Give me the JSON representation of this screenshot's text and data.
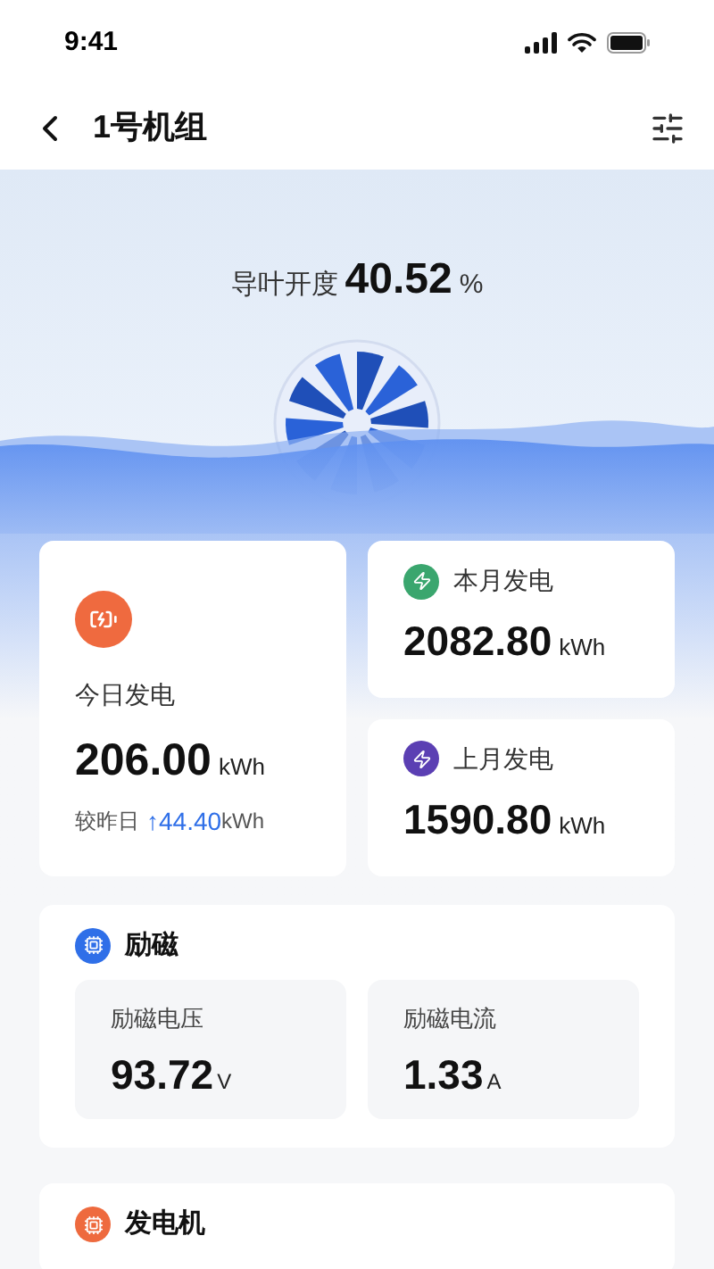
{
  "status_bar": {
    "time": "9:41"
  },
  "header": {
    "title": "1号机组"
  },
  "guide_vane": {
    "label": "导叶开度",
    "value": "40.52",
    "unit": "%"
  },
  "today": {
    "label": "今日发电",
    "value": "206.00",
    "unit": "kWh",
    "compare_label": "较昨日",
    "trend_arrow": "↑",
    "change": "44.40",
    "change_unit": "kWh"
  },
  "monthly": [
    {
      "label": "本月发电",
      "value": "2082.80",
      "unit": "kWh",
      "color": "#3aa66e"
    },
    {
      "label": "上月发电",
      "value": "1590.80",
      "unit": "kWh",
      "color": "#5b3fb3"
    }
  ],
  "sections": [
    {
      "title": "励磁",
      "color": "#2f6fe8",
      "metrics": [
        {
          "label": "励磁电压",
          "value": "93.72",
          "unit": "V"
        },
        {
          "label": "励磁电流",
          "value": "1.33",
          "unit": "A"
        }
      ]
    },
    {
      "title": "发电机",
      "color": "#ee6a3e"
    }
  ]
}
